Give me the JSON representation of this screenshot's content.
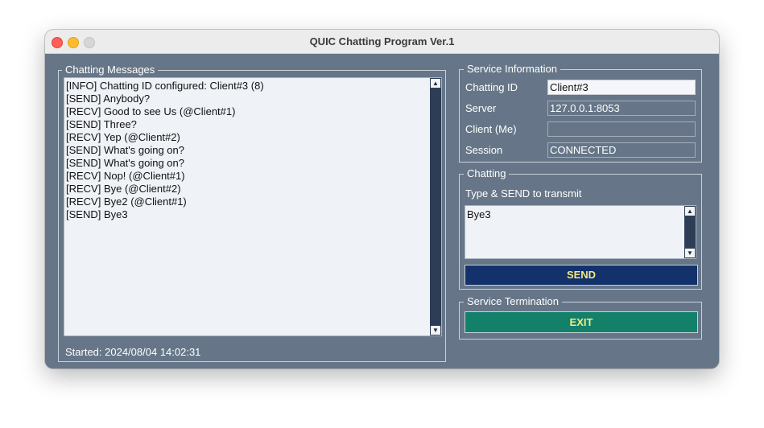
{
  "window": {
    "title": "QUIC Chatting Program Ver.1"
  },
  "messages_panel": {
    "label": "Chatting Messages",
    "lines": [
      "[INFO] Chatting ID configured: Client#3 (8)",
      "[SEND] Anybody?",
      "[RECV] Good to see Us (@Client#1)",
      "[SEND] Three?",
      "[RECV] Yep (@Client#2)",
      "[SEND] What's going on?",
      "[SEND] What's going on?",
      "[RECV] Nop! (@Client#1)",
      "[RECV] Bye (@Client#2)",
      "[RECV] Bye2 (@Client#1)",
      "[SEND] Bye3"
    ],
    "started": "Started: 2024/08/04 14:02:31"
  },
  "service_info": {
    "label": "Service Information",
    "chatting_id": {
      "label": "Chatting ID",
      "value": "Client#3"
    },
    "server": {
      "label": "Server",
      "value": "127.0.0.1:8053"
    },
    "client": {
      "label": "Client (Me)",
      "value": ""
    },
    "session": {
      "label": "Session",
      "value": "CONNECTED"
    }
  },
  "chatting": {
    "label": "Chatting",
    "hint": "Type & SEND to transmit",
    "input_value": "Bye3",
    "send_label": "SEND"
  },
  "termination": {
    "label": "Service Termination",
    "exit_label": "EXIT"
  },
  "colors": {
    "window_bg": "#667688",
    "send_button": "#13326b",
    "exit_button": "#13806a",
    "button_text": "#f1e98a",
    "scrollbar": "#2d3d56"
  },
  "icons": [
    "close-icon",
    "minimize-icon",
    "zoom-icon",
    "scroll-up-icon",
    "scroll-down-icon"
  ]
}
